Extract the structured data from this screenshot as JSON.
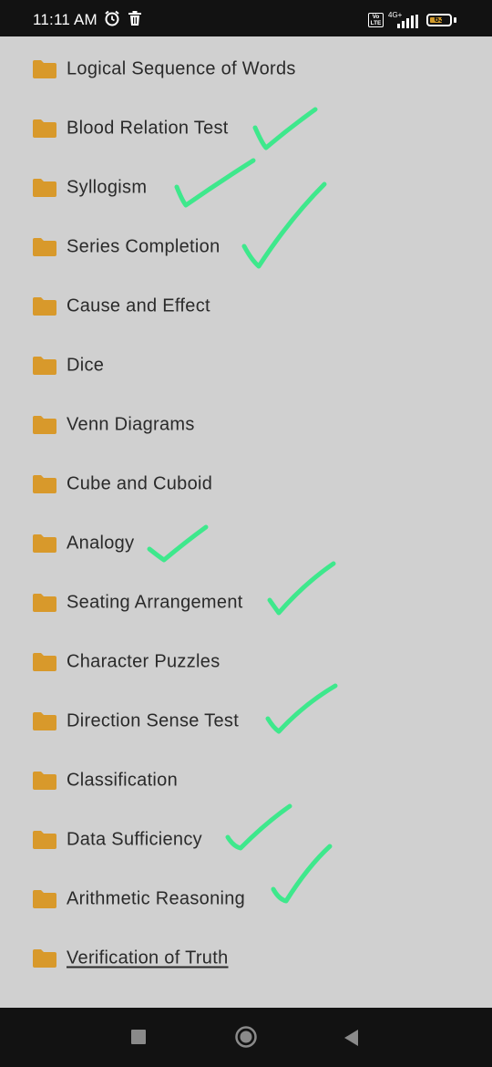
{
  "status_bar": {
    "time": "11:11 AM",
    "network": "4G+",
    "volte": "Vo LTE",
    "battery_level": "63",
    "battery_fraction": 0.63
  },
  "list": {
    "items": [
      {
        "label": "Logical Sequence of Words",
        "checked": false
      },
      {
        "label": "Blood Relation Test",
        "checked": true
      },
      {
        "label": "Syllogism",
        "checked": true
      },
      {
        "label": "Series Completion",
        "checked": true
      },
      {
        "label": "Cause and Effect",
        "checked": false
      },
      {
        "label": "Dice",
        "checked": false
      },
      {
        "label": "Venn Diagrams",
        "checked": false
      },
      {
        "label": "Cube and Cuboid",
        "checked": false
      },
      {
        "label": "Analogy",
        "checked": true
      },
      {
        "label": "Seating Arrangement",
        "checked": true
      },
      {
        "label": "Character Puzzles",
        "checked": false
      },
      {
        "label": "Direction Sense Test",
        "checked": true
      },
      {
        "label": "Classification",
        "checked": false
      },
      {
        "label": "Data Sufficiency",
        "checked": true
      },
      {
        "label": "Arithmetic Reasoning",
        "checked": true
      },
      {
        "label": "Verification of Truth",
        "checked": false
      }
    ]
  },
  "colors": {
    "folder": "#d8992b",
    "checkmark": "#3ee88c",
    "background": "#d0d0d0",
    "bars": "#121212"
  },
  "icons": {
    "folder": "folder-icon",
    "alarm": "alarm-icon",
    "delete": "trash-icon",
    "nav_recents": "square-icon",
    "nav_home": "circle-icon",
    "nav_back": "triangle-back-icon"
  }
}
